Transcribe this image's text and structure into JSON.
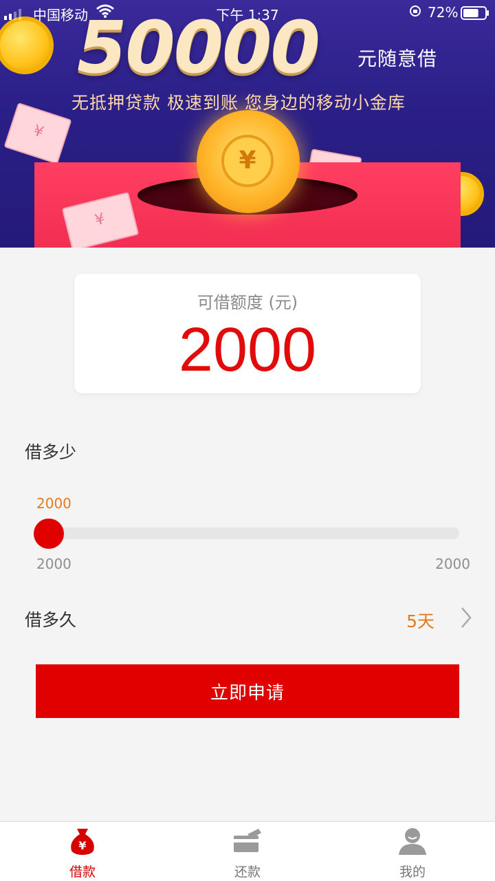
{
  "status_bar": {
    "carrier": "中国移动",
    "time": "下午 1:37",
    "battery": "72%",
    "battery_level": 0.72
  },
  "banner": {
    "amount": "50000",
    "amount_suffix": "元随意借",
    "tagline": "无抵押贷款  极速到账   您身边的移动小金库",
    "coin_symbol": "¥",
    "bill_symbol": "¥"
  },
  "quota": {
    "label": "可借额度 (元)",
    "value": "2000"
  },
  "amount_section": {
    "label": "借多少",
    "current": "2000",
    "min": "2000",
    "max": "2000",
    "fraction": 0
  },
  "term_section": {
    "label": "借多久",
    "value": "5天"
  },
  "apply_button": "立即申请",
  "tabbar": {
    "items": [
      {
        "label": "借款",
        "icon": "money-bag-icon",
        "active": true
      },
      {
        "label": "还款",
        "icon": "card-icon",
        "active": false
      },
      {
        "label": "我的",
        "icon": "user-icon",
        "active": false
      }
    ]
  },
  "colors": {
    "accent": "#e00000",
    "amount_text": "#e20b0b",
    "secondary_value": "#e27b1c",
    "banner_bg": "#2a1f86"
  }
}
